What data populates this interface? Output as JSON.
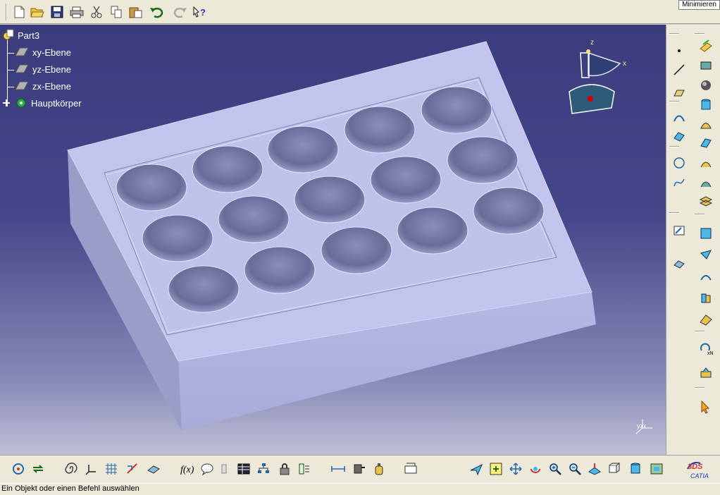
{
  "window": {
    "minimize_label": "Minimieren"
  },
  "tree": {
    "root": "Part3",
    "items": [
      {
        "label": "xy-Ebene"
      },
      {
        "label": "yz-Ebene"
      },
      {
        "label": "zx-Ebene"
      },
      {
        "label": "Hauptkörper"
      }
    ]
  },
  "compass": {
    "x_label": "x",
    "z_label": "z"
  },
  "axis_indicator": {
    "label": "yzx"
  },
  "status": {
    "message": "Ein Objekt oder einen Befehl auswählen"
  },
  "brand": {
    "logo_text": "CATIA",
    "logo_mark": "3DS"
  },
  "toolbar_top": [
    "new-icon",
    "open-icon",
    "save-icon",
    "print-icon",
    "cut-icon",
    "copy-icon",
    "paste-icon",
    "undo-icon",
    "redo-icon",
    "whats-this-icon"
  ],
  "colors": {
    "viewport_top": "#3a3c7e",
    "viewport_bottom": "#bebfd6",
    "part_face": "#c2c3ec",
    "toolbar": "#ece9d8"
  }
}
